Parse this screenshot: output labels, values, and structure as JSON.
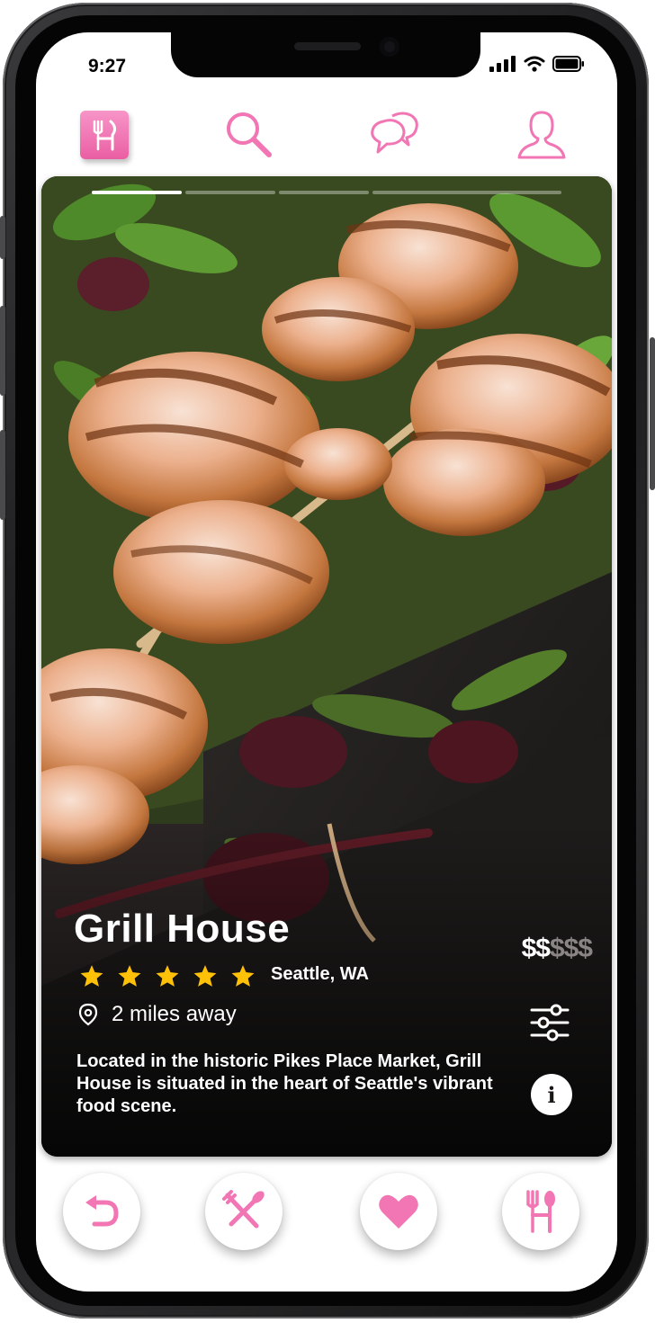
{
  "status_bar": {
    "time": "9:27"
  },
  "top_nav": {
    "items": [
      {
        "icon": "fork-knife-logo-icon"
      },
      {
        "icon": "search-icon"
      },
      {
        "icon": "chat-bubbles-icon"
      },
      {
        "icon": "profile-icon"
      }
    ]
  },
  "card": {
    "progress_segments": 4,
    "active_segment": 1,
    "title": "Grill House",
    "rating": 5,
    "location": "Seattle, WA",
    "price": {
      "active": "$$",
      "inactive": "$$$"
    },
    "distance": "2 miles away",
    "description": "Located in the historic Pikes Place Market, Grill House is situated in the heart of Seattle's vibrant food scene.",
    "info_label": "i"
  },
  "actions": [
    {
      "icon": "undo-icon"
    },
    {
      "icon": "crossed-utensils-icon"
    },
    {
      "icon": "heart-icon"
    },
    {
      "icon": "fork-spoon-icon"
    }
  ],
  "colors": {
    "accent_pink": "#f276b4",
    "star_yellow": "#ffc107",
    "price_muted": "#8a8584"
  }
}
